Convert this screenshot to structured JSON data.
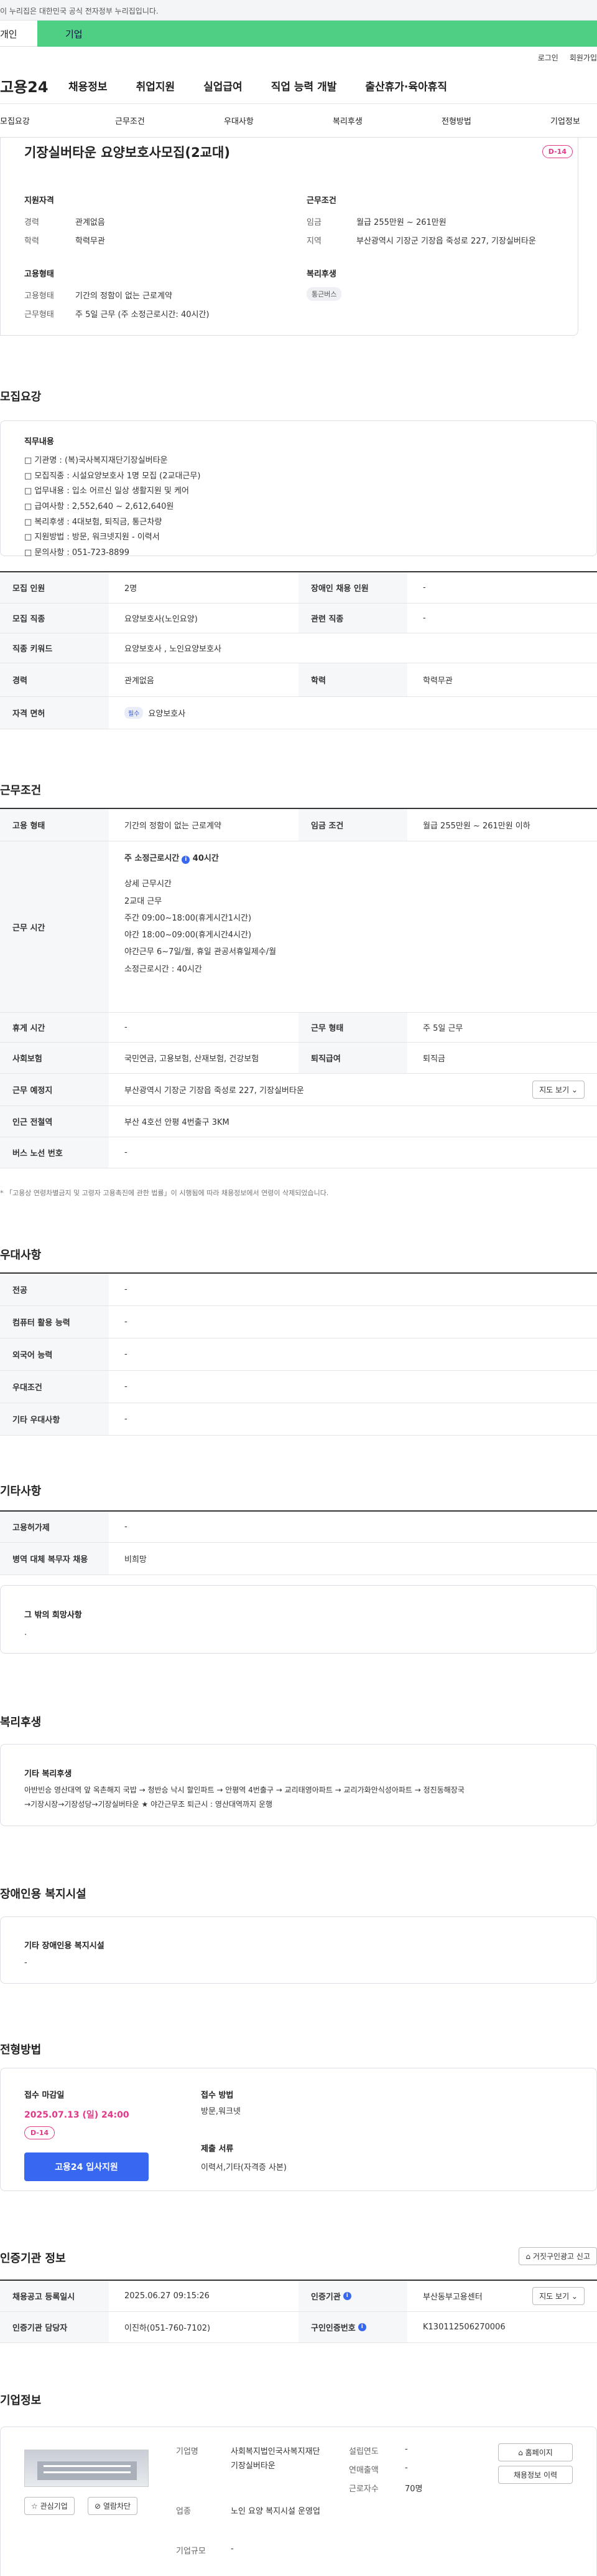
{
  "gov_banner": "이 누리집은 대한민국 공식 전자정부 누리집입니다.",
  "top_tabs": {
    "personal": "개인",
    "company": "기업"
  },
  "util": {
    "login": "로그인",
    "signup": "회원가입"
  },
  "gnb": {
    "logo": "고용24",
    "menu": [
      "채용정보",
      "취업지원",
      "실업급여",
      "직업 능력 개발",
      "출산휴가·육아휴직"
    ]
  },
  "subnav": [
    "모집요강",
    "근무조건",
    "우대사항",
    "복리후생",
    "전형방법",
    "기업정보"
  ],
  "header": {
    "title": "기장실버타운 요양보호사모집(2교대)",
    "dday": "D-14",
    "qual_title": "지원자격",
    "career_label": "경력",
    "career_value": "관계없음",
    "edu_label": "학력",
    "edu_value": "학력무관",
    "work_title": "근무조건",
    "wage_label": "임금",
    "wage_value": "월급 255만원 ~ 261만원",
    "region_label": "지역",
    "region_value": "부산광역시 기장군 기장읍 죽성로 227, 기장실버타운",
    "emp_title": "고용형태",
    "emp_type_label": "고용형태",
    "emp_type_value": "기간의 정함이 없는 근로계약",
    "work_form_label": "근무형태",
    "work_form_value": "주 5일 근무 (주 소정근로시간: 40시간)",
    "welfare_title": "복리후생",
    "welfare_pill": "통근버스"
  },
  "recruit": {
    "section_title": "모집요강",
    "duty_title": "직무내용",
    "duty_lines": [
      "□ 기관명 : (복)국사복지재단기장실버타운",
      "□ 모집직종 : 시설요양보호사 1명 모집 (2교대근무)",
      "□ 업무내용 : 입소 어르신 일상 생활지원 및 케어",
      "□ 급여사항 : 2,552,640 ~ 2,612,640원",
      "□ 복리후생 : 4대보험, 퇴직금, 통근차량",
      "□ 지원방법 : 방문, 워크넷지원 - 이력서",
      "□ 문의사항 : 051-723-8899"
    ],
    "rows": [
      {
        "th": "모집 인원",
        "td": "2명",
        "th2": "장애인 채용 인원",
        "td2": "-"
      },
      {
        "th": "모집 직종",
        "td": "요양보호사(노인요양)",
        "th2": "관련 직종",
        "td2": "-"
      },
      {
        "th": "직종 키워드",
        "td": "요양보호사 , 노인요양보호사"
      },
      {
        "th": "경력",
        "td": "관계없음",
        "th2": "학력",
        "td2": "학력무관"
      },
      {
        "th": "자격 면허",
        "badge": "필수",
        "td": "요양보호사"
      }
    ]
  },
  "conditions": {
    "section_title": "근무조건",
    "emp_type_th": "고용 형태",
    "emp_type_td": "기간의 정함이 없는 근로계약",
    "wage_th": "임금 조건",
    "wage_td": "월급 255만원 ~ 261만원 이하",
    "hours_th": "근무 시간",
    "hours_weekly": "주 소정근로시간",
    "hours_weekly_val": "40시간",
    "hours_lines": [
      "상세 근무시간",
      "2교대 근무",
      "주간 09:00~18:00(휴게시간1시간)",
      "야간 18:00~09:00(휴게시간4시간)",
      "야간근무 6~7일/월, 휴일 관공서휴일제수/월",
      "소정근로시간 : 40시간"
    ],
    "rest_th": "휴게 시간",
    "rest_td": "-",
    "form_th": "근무 형태",
    "form_td": "주 5일 근무",
    "insurance_th": "사회보험",
    "insurance_td": "국민연금, 고용보험, 산재보험, 건강보험",
    "retire_th": "퇴직급여",
    "retire_td": "퇴직금",
    "place_th": "근무 예정지",
    "place_td": "부산광역시 기장군 기장읍 죽성로 227, 기장실버타운",
    "map_btn": "지도 보기 ⌄",
    "subway_th": "인근 전철역",
    "subway_td": "부산 4호선 안평 4번출구 3KM",
    "bus_th": "버스 노선 번호",
    "bus_td": "-",
    "note": "* 「고용상 연령차별금지 및 고령자 고용촉진에 관한 법률」이 시행됨에 따라 채용정보에서 연령이 삭제되었습니다."
  },
  "preference": {
    "section_title": "우대사항",
    "rows": [
      {
        "th": "전공",
        "td": "-"
      },
      {
        "th": "컴퓨터 활용 능력",
        "td": "-"
      },
      {
        "th": "외국어 능력",
        "td": "-"
      },
      {
        "th": "우대조건",
        "td": "-"
      },
      {
        "th": "기타 우대사항",
        "td": "-"
      }
    ]
  },
  "other": {
    "section_title": "기타사항",
    "rows": [
      {
        "th": "고용허가제",
        "td": "-"
      },
      {
        "th": "병역 대체 복무자 채용",
        "td": "비희망"
      }
    ],
    "extra_title": "그 밖의 희망사항",
    "extra_value": "."
  },
  "welfare": {
    "section_title": "복리후생",
    "box_title": "기타 복리후생",
    "lines": [
      "아반빈승 영산대역 앞 옥촌해지 국밥 → 청반승 낙시 할인파트 → 안평역 4번출구 → 교리태영아파트 → 교리가화안식성아파트 → 정진동해장국",
      "→기장시장→기장성당→기장실버타운 ★ 야간근무조 퇴근시 : 영산대역까지 운행"
    ]
  },
  "disabled": {
    "section_title": "장애인용 복지시설",
    "box_title": "기타 장애인용 복지시설",
    "value": "-"
  },
  "selection": {
    "section_title": "전형방법",
    "deadline_title": "접수 마감일",
    "deadline_value": "2025.07.13 (일) 24:00",
    "dday": "D-14",
    "apply_btn": "고용24 입사지원",
    "method_title": "접수 방법",
    "method_value": "방문,워크넷",
    "docs_title": "제출 서류",
    "docs_value": "이력서,기타(자격증 사본)"
  },
  "cert": {
    "section_title": "인증기관 정보",
    "report_btn": "거짓구인광고 신고",
    "rows": [
      {
        "th": "채용공고 등록일시",
        "td": "2025.06.27 09:15:26",
        "th2": "인증기관",
        "td2": "부산동부고용센터",
        "btn": "지도 보기 ⌄"
      },
      {
        "th": "인증기관 담당자",
        "td": "이진하(051-760-7102)",
        "th2": "구인인증번호",
        "td2": "K130112506270006"
      }
    ]
  },
  "company": {
    "section_title": "기업정보",
    "interest_btn": "관심기업",
    "block_btn": "열람차단",
    "name_label": "기업명",
    "name_value": "사회복지법인국사복지재단 기장실버타운",
    "industry_label": "업종",
    "industry_value": "노인 요양 복지시설 운영업",
    "scale_label": "기업규모",
    "scale_value": "-",
    "founded_label": "설립연도",
    "founded_value": "-",
    "sales_label": "연매출액",
    "sales_value": "-",
    "employees_label": "근로자수",
    "employees_value": "70명",
    "homepage_btn": "홈페이지",
    "list_btn": "채용정보 이력"
  }
}
